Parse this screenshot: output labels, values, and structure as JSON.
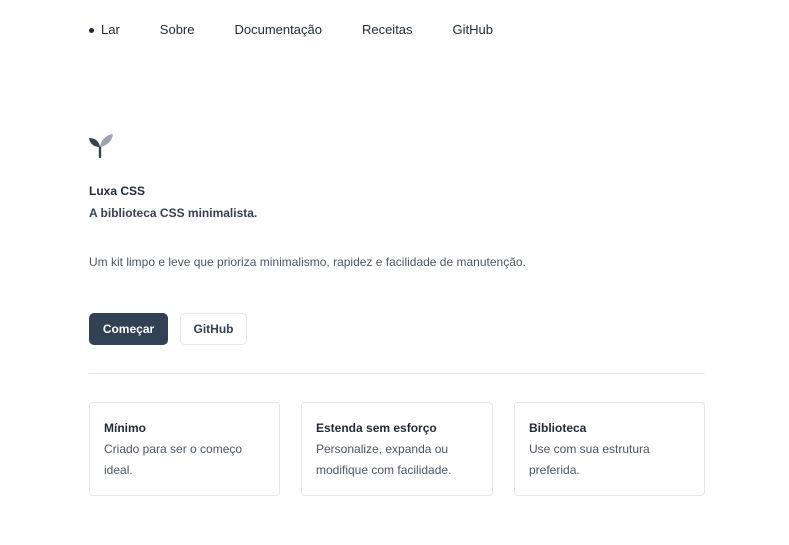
{
  "nav": {
    "items": [
      {
        "label": "Lar"
      },
      {
        "label": "Sobre"
      },
      {
        "label": "Documentação"
      },
      {
        "label": "Receitas"
      },
      {
        "label": "GitHub"
      }
    ]
  },
  "hero": {
    "logo_icon": "sprout-icon",
    "name": "Luxa CSS",
    "tagline": "A biblioteca CSS minimalista.",
    "description": "Um kit limpo e leve que prioriza minimalismo, rapidez e facilidade de manutenção.",
    "primary_button": "Começar",
    "secondary_button": "GitHub"
  },
  "features": [
    {
      "title": "Mínimo",
      "text": "Criado para ser o começo ideal."
    },
    {
      "title": "Estenda sem esforço",
      "text": "Personalize, expanda ou modifique com facilidade."
    },
    {
      "title": "Biblioteca",
      "text": "Use com sua estrutura preferida."
    }
  ],
  "colors": {
    "primary": "#334155",
    "border": "#e5e7eb",
    "text": "#1f2937",
    "muted": "#4b5563",
    "logo_dark": "#374151",
    "logo_light": "#9ca3af"
  }
}
